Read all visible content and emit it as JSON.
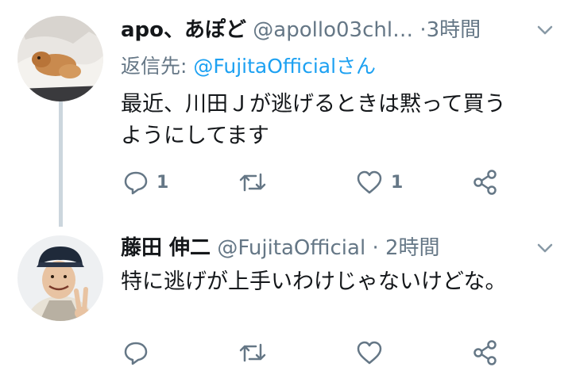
{
  "tweets": [
    {
      "display_name": "apo、あぽど",
      "handle": "@apollo03chl…",
      "separator": "·",
      "time": "3時間",
      "replying_prefix": "返信先: ",
      "replying_to": "@FujitaOfficialさん",
      "text_line1": "最近、川田Ｊが逃げるときは黙って買う",
      "text_line2": "ようにしてます",
      "reply_count": "1",
      "retweet_count": "",
      "like_count": "1"
    },
    {
      "display_name": "藤田 伸二",
      "handle": "@FujitaOfficial",
      "separator": "·",
      "time": "2時間",
      "text_line1": "特に逃げが上手いわけじゃないけどな。",
      "reply_count": "",
      "retweet_count": "",
      "like_count": ""
    }
  ],
  "colors": {
    "secondary": "#657786",
    "link": "#1da1f2",
    "thread_line": "#ccd6dd"
  }
}
